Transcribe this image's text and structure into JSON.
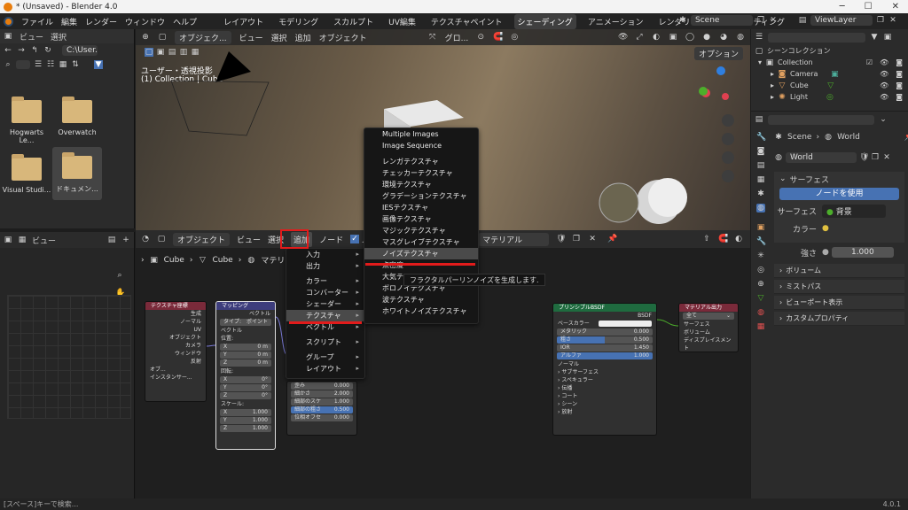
{
  "title": "* (Unsaved) - Blender 4.0",
  "menubar": {
    "menus": [
      "ファイル",
      "編集",
      "レンダー",
      "ウィンドウ",
      "ヘルプ"
    ],
    "workspaces": [
      "レイアウト",
      "モデリング",
      "スカルプト",
      "UV編集",
      "テクスチャペイント",
      "シェーディング",
      "アニメーション",
      "レンダリング",
      "コンポジティング"
    ],
    "active_workspace": "シェーディング",
    "scene": "Scene",
    "viewlayer": "ViewLayer"
  },
  "filebrowser": {
    "menus": [
      "ビュー",
      "選択"
    ],
    "path": "C:\\User...",
    "items": [
      "Hogwarts Le...",
      "Overwatch",
      "Visual Studi...",
      "ドキュメン..."
    ]
  },
  "viewport": {
    "header": [
      "オブジェク...",
      "ビュー",
      "選択",
      "追加",
      "オブジェクト"
    ],
    "shading": "グロ...",
    "options": "オプション",
    "overlay1": "ユーザー・透視投影",
    "overlay2": "(1) Collection | Cube"
  },
  "nodeeditor": {
    "header": [
      "オブジェクト",
      "ビュー",
      "選択",
      "追加",
      "ノード"
    ],
    "use_nodes_label": "ノ",
    "slot": "マテリアル",
    "breadcrumb": [
      "Cube",
      "Cube",
      "マテリア"
    ],
    "nodes": {
      "texcoord": {
        "title": "テクスチャ座標",
        "outputs": [
          "生成",
          "ノーマル",
          "UV",
          "オブジェクト",
          "カメラ",
          "ウィンドウ",
          "反射"
        ],
        "obj": "オブ...",
        "inst": "インスタンサー..."
      },
      "mapping": {
        "title": "マッピング",
        "out": "ベクトル",
        "type_label": "タイプ:",
        "type": "ポイント",
        "vector": "ベクトル",
        "loc": "位置:",
        "rot": "回転:",
        "scale": "スケール:",
        "loc_vals": [
          [
            "X",
            "0 m"
          ],
          [
            "Y",
            "0 m"
          ],
          [
            "Z",
            "0 m"
          ]
        ],
        "rot_vals": [
          [
            "X",
            "0°"
          ],
          [
            "Y",
            "0°"
          ],
          [
            "Z",
            "0°"
          ]
        ],
        "scale_vals": [
          [
            "X",
            "1.000"
          ],
          [
            "Y",
            "1.000"
          ],
          [
            "Z",
            "1.000"
          ]
        ]
      },
      "noise": {
        "rows": [
          [
            "歪み",
            "0.000"
          ],
          [
            "細かさ",
            "2.000"
          ],
          [
            "細部のスケ",
            "1.000"
          ],
          [
            "細部の粗さ",
            "0.500"
          ],
          [
            "位相オフセ",
            "0.000"
          ]
        ]
      },
      "bsdf": {
        "title": "プリンシプルBSDF",
        "out": "BSDF",
        "rows": [
          [
            "ベースカラー",
            ""
          ],
          [
            "メタリック",
            "0.000"
          ],
          [
            "粗さ",
            "0.500"
          ],
          [
            "IOR",
            "1.450"
          ],
          [
            "アルファ",
            "1.000"
          ]
        ],
        "subs": [
          "ノーマル",
          "サブサーフェス",
          "スペキュラー",
          "伝播",
          "コート",
          "シーン",
          "放射"
        ]
      },
      "output": {
        "title": "マテリアル出力",
        "target": "全て",
        "inputs": [
          "サーフェス",
          "ボリューム",
          "ディスプレイスメント"
        ]
      }
    }
  },
  "add_menu": {
    "items": [
      "入力",
      "出力",
      "カラー",
      "コンバーター",
      "シェーダー",
      "テクスチャ",
      "ベクトル",
      "スクリプト",
      "グループ",
      "レイアウト"
    ],
    "highlighted": "テクスチャ"
  },
  "texture_menu": {
    "items": [
      "Multiple Images",
      "Image Sequence",
      "レンガテクスチャ",
      "チェッカーテクスチャ",
      "環境テクスチャ",
      "グラデーションテクスチャ",
      "IESテクスチャ",
      "画像テクスチャ",
      "マジックテクスチャ",
      "マスグレイブテクスチャ",
      "ノイズテクスチャ",
      "点密度",
      "大気テ",
      "ボロノイテクスチャ",
      "波テクスチャ",
      "ホワイトノイズテクスチャ"
    ],
    "highlighted": "ノイズテクスチャ",
    "tooltip": "フラクタルパーリンノイズを生成します."
  },
  "outliner": {
    "title": "シーンコレクション",
    "rows": [
      "Collection",
      "Camera",
      "Cube",
      "Light"
    ]
  },
  "properties": {
    "scene": "Scene",
    "world": "World",
    "world_field": "World",
    "surface_header": "サーフェス",
    "use_nodes": "ノードを使用",
    "surface_label": "サーフェス",
    "surface_value": "背景",
    "color_label": "カラー",
    "strength_label": "強さ",
    "strength_value": "1.000",
    "sections": [
      "ボリューム",
      "ミストパス",
      "ビューポート表示",
      "カスタムプロパティ"
    ]
  },
  "statusbar": {
    "hint": "[スペース]キーで検索...",
    "version": "4.0.1"
  },
  "colors": {
    "accent": "#4772b3",
    "highlight": "#e21b1b",
    "bsdf_header": "#1f6b3f",
    "vector_header": "#3d3d7c",
    "input_header": "#7a2a3a"
  }
}
